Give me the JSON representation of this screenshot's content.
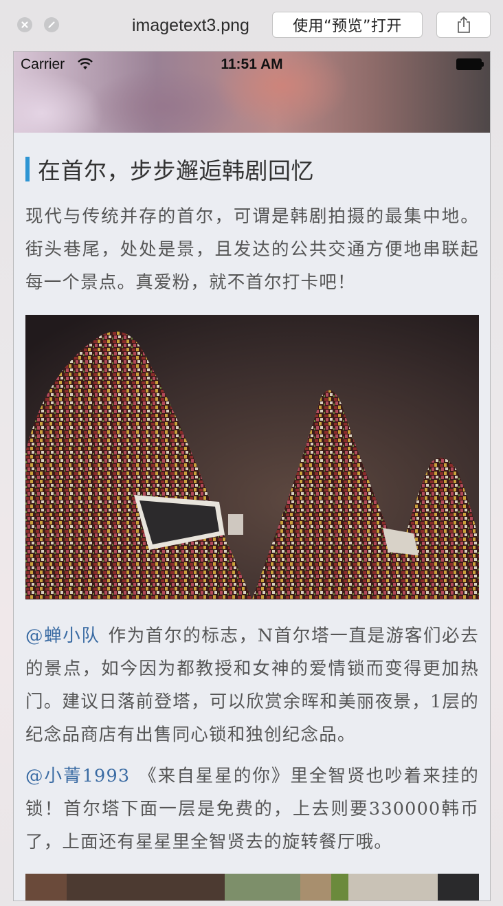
{
  "window": {
    "filename": "imagetext3.png",
    "open_with_preview_label": "使用“预览”打开",
    "close_icon": "close-icon",
    "fullscreen_icon": "fullscreen-icon",
    "share_icon": "share-icon"
  },
  "statusbar": {
    "carrier": "Carrier",
    "time": "11:51 AM",
    "wifi_icon": "wifi-icon",
    "battery_icon": "battery-icon"
  },
  "article": {
    "title": "在首尔，步步邂逅韩剧回忆",
    "intro": "现代与传统并存的首尔，可谓是韩剧拍摄的最集中地。街头巷尾，处处是景，且发达的公共交通方便地串联起每一个景点。真爱粉，就不首尔打卡吧！",
    "comments": [
      {
        "author": "@蝉小队",
        "text": "作为首尔的标志，N首尔塔一直是游客们必去的景点，如今因为都教授和女神的爱情锁而变得更加热门。建议日落前登塔，可以欣赏余晖和美丽夜景，1层的纪念品商店有出售同心锁和独创纪念品。"
      },
      {
        "author": "@小菁1993",
        "text": "《来自星星的你》里全智贤也吵着来挂的锁！首尔塔下面一层是免费的，上去则要330000韩币了，上面还有星星里全智贤去的旋转餐厅哦。"
      }
    ],
    "accent_color": "#2e95d3",
    "mention_color": "#3a6ba3"
  }
}
